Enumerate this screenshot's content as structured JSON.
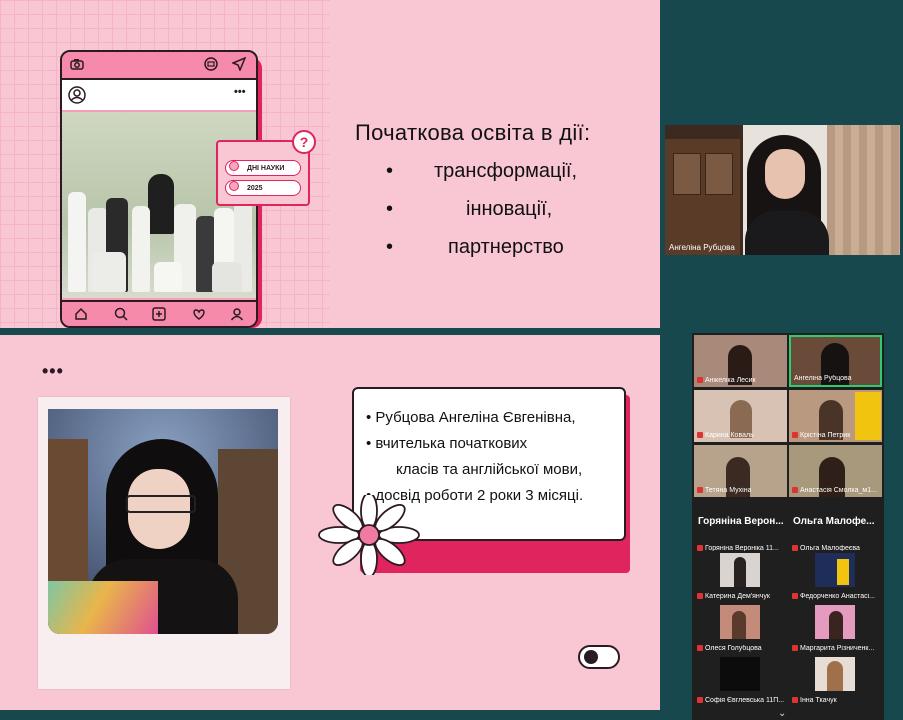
{
  "slide1": {
    "title": "Початкова освіта в дії:",
    "bullets": [
      "трансформації,",
      "інновації,",
      "партнерство"
    ],
    "card": {
      "line1": "ДНІ НАУКИ",
      "line2": "2025"
    },
    "qmark": "?",
    "more": "•••"
  },
  "video": {
    "name": "Ангеліна Рубцова"
  },
  "slide2": {
    "dots": "•••",
    "lines": [
      "• Рубцова Ангеліна Євгенівна,",
      "• вчителька початкових",
      "класів та англійської мови,",
      "• досвід роботи 2 роки 3 місяці."
    ]
  },
  "participants": {
    "video_tiles": [
      {
        "name": "Анжеліка Лесик"
      },
      {
        "name": "Ангеліна Рубцова"
      },
      {
        "name": "Карина Коваль"
      },
      {
        "name": "Крістіна Петрик"
      },
      {
        "name": "Тетяна Мухіна"
      },
      {
        "name": "Анастасія Смолка_м1..."
      }
    ],
    "name_tiles": [
      {
        "big": "Горяніна Верон...",
        "name": "Горяніна Вероніка 11..."
      },
      {
        "big": "Ольга Малофе...",
        "name": "Ольга Малофеєва"
      }
    ],
    "photo_tiles": [
      {
        "name": "Катерина Дем'янчук"
      },
      {
        "name": "Федорченко Анастасі..."
      },
      {
        "name": "Олеся Голубцова"
      },
      {
        "name": "Маргарита Різниченк..."
      },
      {
        "name": "Софія Євглевська 11П..."
      },
      {
        "name": "Інна Ткачук"
      }
    ]
  },
  "colors": {
    "accent": "#e0245e",
    "slide_bg": "#f9c6d4",
    "app_bg": "#16484d"
  }
}
